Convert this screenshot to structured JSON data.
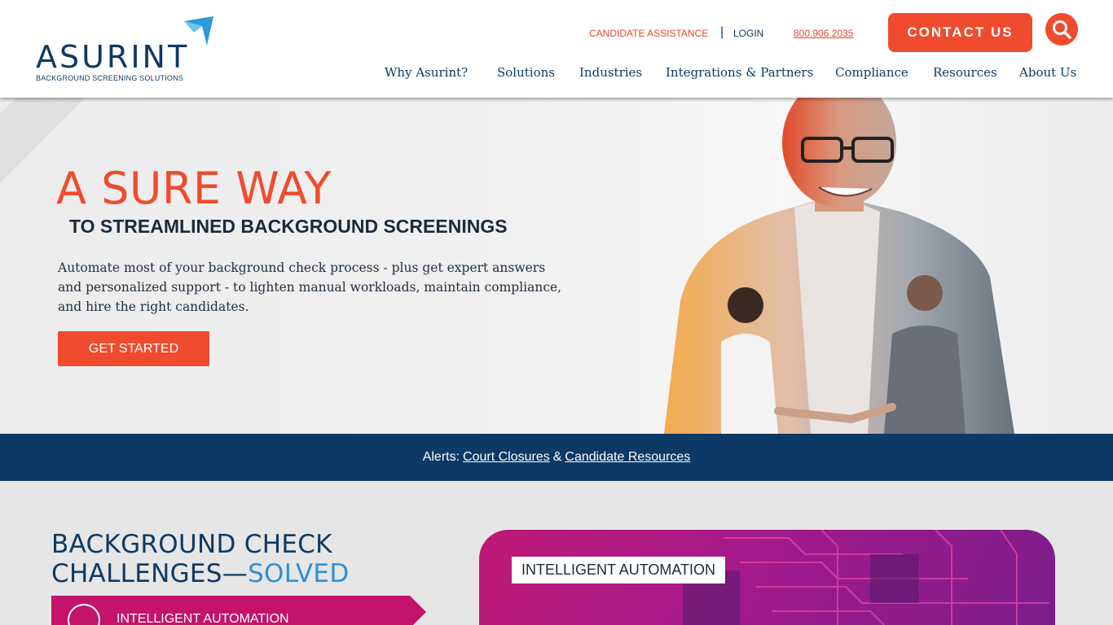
{
  "header": {
    "logo_word": "ASURINT",
    "logo_tagline": "BACKGROUND SCREENING SOLUTIONS",
    "utility": {
      "candidate_assistance": "CANDIDATE ASSISTANCE",
      "separator": "|",
      "login": "LOGIN",
      "phone": "800.906.2035"
    },
    "contact_label": "CONTACT US",
    "search_icon": "search-icon",
    "nav": [
      "Why Asurint?",
      "Solutions",
      "Industries",
      "Integrations & Partners",
      "Compliance",
      "Resources",
      "About Us"
    ]
  },
  "hero": {
    "title": "A SURE WAY",
    "subtitle": "TO STREAMLINED BACKGROUND SCREENINGS",
    "body": "Automate most of your background check process - plus get expert answers and personalized support - to lighten manual workloads, maintain compliance, and hire the right candidates.",
    "cta": "GET STARTED"
  },
  "alert": {
    "prefix": "Alerts:",
    "link1": "Court Closures",
    "joiner": "&",
    "link2": "Candidate Resources"
  },
  "lower": {
    "title_line1": "BACKGROUND CHECK",
    "title_line2_prefix": "CHALLENGES—",
    "title_line2_highlight": "SOLVED",
    "accordion_label": "INTELLIGENT AUTOMATION",
    "card_label": "INTELLIGENT AUTOMATION"
  },
  "colors": {
    "brand_navy": "#0e3a63",
    "brand_orange": "#f04b2e",
    "accent_blue": "#2f8fd6",
    "accent_magenta": "#c4136b",
    "alert_bar": "#0d3966"
  }
}
